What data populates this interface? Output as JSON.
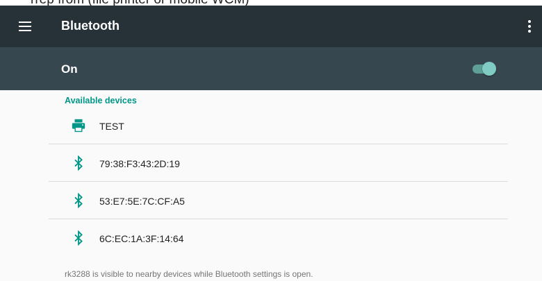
{
  "colors": {
    "appbar": "#263238",
    "switchbar": "#37474f",
    "accent": "#009688",
    "toggle_thumb": "#80cbc4"
  },
  "top_strip": {
    "partial_text": "rrep from (file printer or mobile WCM)"
  },
  "appbar": {
    "menu_icon": "hamburger-menu-icon",
    "title": "Bluetooth",
    "overflow_icon": "more-vert-icon"
  },
  "switchbar": {
    "label": "On",
    "toggle_state": "on"
  },
  "available_devices": {
    "header": "Available devices",
    "devices": [
      {
        "name": "TEST",
        "icon": "printer-icon"
      },
      {
        "name": "79:38:F3:43:2D:19",
        "icon": "bluetooth-icon"
      },
      {
        "name": "53:E7:5E:7C:CF:A5",
        "icon": "bluetooth-icon"
      },
      {
        "name": "6C:EC:1A:3F:14:64",
        "icon": "bluetooth-icon"
      }
    ]
  },
  "footer": {
    "visibility_text": "rk3288 is visible to nearby devices while Bluetooth settings is open."
  }
}
